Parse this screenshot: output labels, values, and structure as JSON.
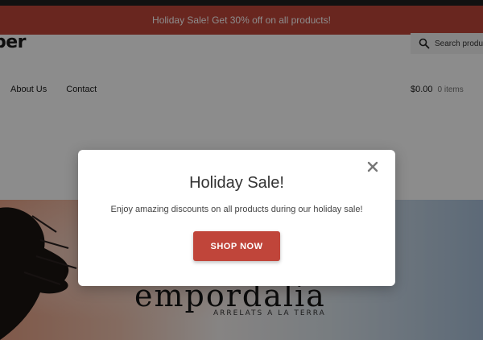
{
  "colors": {
    "accent": "#c0453a",
    "top_bar": "#1f1f1f"
  },
  "promo": {
    "text": "Holiday Sale! Get 30% off on all products!"
  },
  "header": {
    "logo_text": "per",
    "search_placeholder": "Search products",
    "search_icon": "search-icon",
    "nav": [
      {
        "label": "About Us"
      },
      {
        "label": "Contact"
      }
    ],
    "cart": {
      "amount": "$0.00",
      "items": "0 items"
    }
  },
  "hero": {
    "brand": "empordalia",
    "tagline": "ARRELATS A LA TERRA"
  },
  "modal": {
    "title": "Holiday Sale!",
    "text": "Enjoy amazing discounts on all products during our holiday sale!",
    "button": "SHOP NOW",
    "close_icon": "close-icon"
  }
}
